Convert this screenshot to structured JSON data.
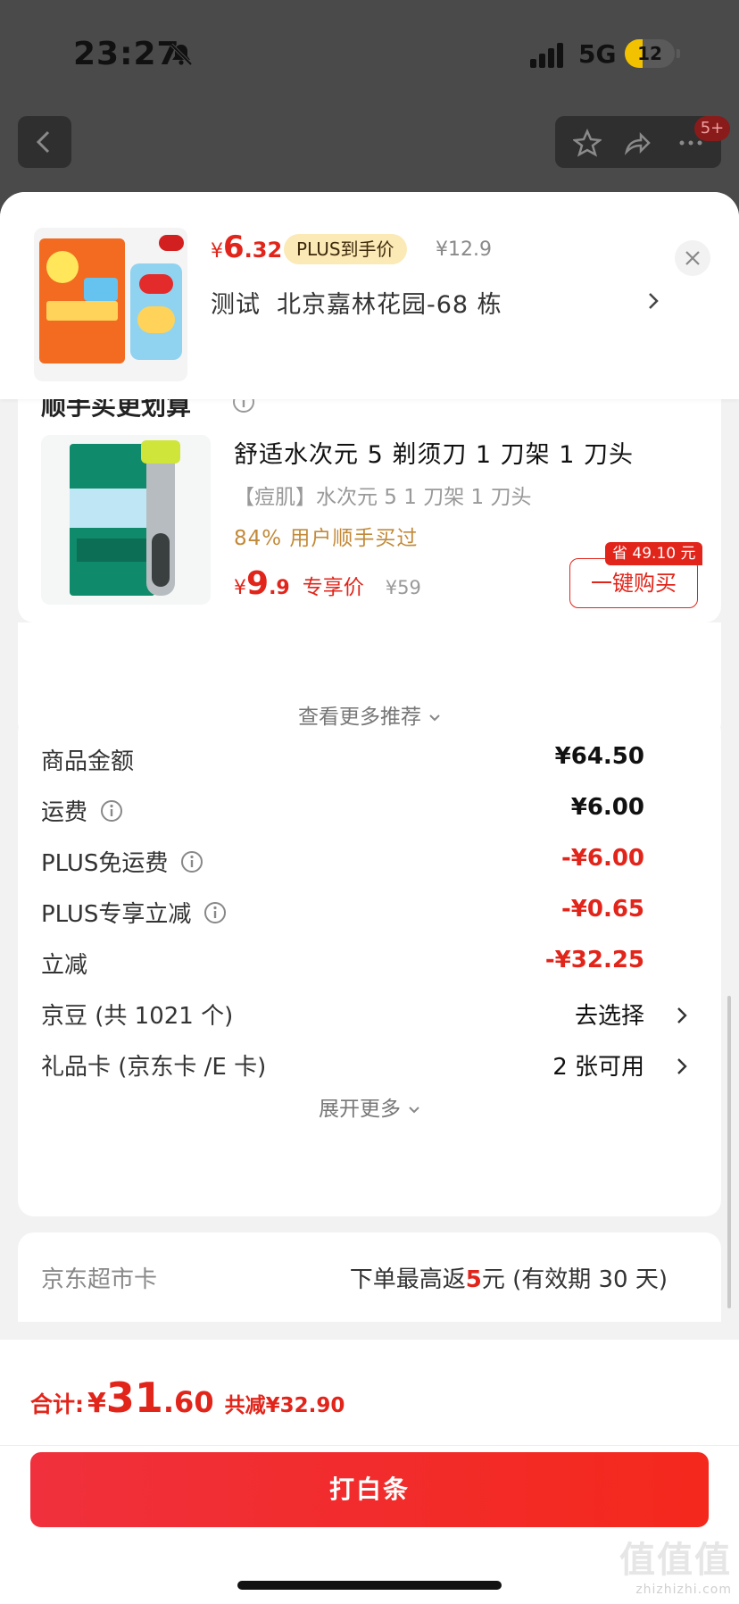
{
  "status_bar": {
    "time": "23:27",
    "network": "5G",
    "battery": "12"
  },
  "nav": {
    "cart_badge": "5+"
  },
  "product": {
    "price_symbol": "¥",
    "price_int": "6",
    "price_dec": ".32",
    "plus_tag": "PLUS到手价",
    "original_price": "¥12.9",
    "address_label": "测试",
    "address": "北京嘉林花园-68 栋"
  },
  "recommend": {
    "title": "顺手买更划算",
    "item": {
      "name": "舒适水次元 5 剃须刀 1 刀架 1 刀头",
      "spec": "【痘肌】水次元 5 1 刀架 1 刀头",
      "buyers": "84% 用户顺手买过",
      "price_symbol": "¥",
      "price_int": "9",
      "price_dec": ".9",
      "price_tag": "专享价",
      "original_price": "¥59",
      "save_badge": "省 49.10 元",
      "buy_button": "一键购买"
    },
    "more": "查看更多推荐"
  },
  "details": {
    "rows": [
      {
        "label": "商品金额",
        "value": "¥64.50"
      },
      {
        "label": "运费",
        "value": "¥6.00"
      },
      {
        "label": "PLUS免运费",
        "value": "-¥6.00"
      },
      {
        "label": "PLUS专享立减",
        "value": "-¥0.65"
      },
      {
        "label": "立减",
        "value": "-¥32.25"
      },
      {
        "label": "京豆 (共 1021 个)",
        "value": "去选择"
      },
      {
        "label": "礼品卡 (京东卡 /E 卡)",
        "value": "2 张可用"
      }
    ],
    "expand": "展开更多"
  },
  "supermarket": {
    "label": "京东超市卡",
    "value_prefix": "下单最高返",
    "value_highlight": "5",
    "value_suffix": "元 (有效期 30 天)"
  },
  "bottom": {
    "total_label": "合计:",
    "total_symbol": "¥",
    "total_int": "31",
    "total_dec": ".60",
    "total_saving": "共减¥32.90",
    "pay_button": "打白条"
  },
  "watermark": {
    "glyphs": "值值值",
    "site": "zhizhizhi.com"
  },
  "colors": {
    "accent_red": "#e1251b",
    "plus_gold": "#fbe9b6",
    "buyers_text": "#c28a3a"
  }
}
